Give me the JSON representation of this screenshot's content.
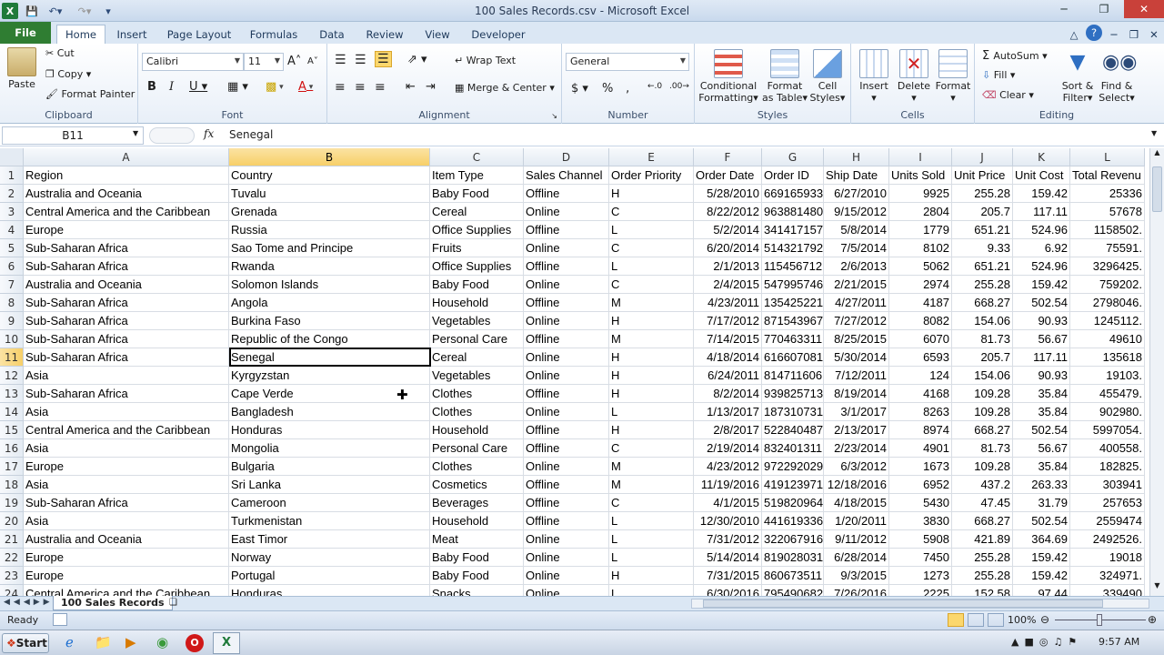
{
  "window": {
    "title": "100 Sales Records.csv - Microsoft Excel"
  },
  "tabs": [
    "File",
    "Home",
    "Insert",
    "Page Layout",
    "Formulas",
    "Data",
    "Review",
    "View",
    "Developer"
  ],
  "ribbon": {
    "clipboard": {
      "label": "Clipboard",
      "paste": "Paste",
      "cut": "Cut",
      "copy": "Copy",
      "format_painter": "Format Painter"
    },
    "font": {
      "label": "Font",
      "name": "Calibri",
      "size": "11"
    },
    "alignment": {
      "label": "Alignment",
      "wrap": "Wrap Text",
      "merge": "Merge & Center"
    },
    "number": {
      "label": "Number",
      "format": "General"
    },
    "styles": {
      "label": "Styles",
      "cond1": "Conditional",
      "cond2": "Formatting",
      "fmt1": "Format",
      "fmt2": "as Table",
      "cell1": "Cell",
      "cell2": "Styles"
    },
    "cells": {
      "label": "Cells",
      "insert": "Insert",
      "delete": "Delete",
      "format": "Format"
    },
    "editing": {
      "label": "Editing",
      "autosum": "AutoSum",
      "fill": "Fill",
      "clear": "Clear",
      "sort1": "Sort &",
      "sort2": "Filter",
      "find1": "Find &",
      "find2": "Select"
    }
  },
  "formula": {
    "name_box": "B11",
    "fx": "fx",
    "value": "Senegal"
  },
  "columns": [
    {
      "letter": "A"
    },
    {
      "letter": "B"
    },
    {
      "letter": "C"
    },
    {
      "letter": "D"
    },
    {
      "letter": "E"
    },
    {
      "letter": "F"
    },
    {
      "letter": "G"
    },
    {
      "letter": "H"
    },
    {
      "letter": "I"
    },
    {
      "letter": "J"
    },
    {
      "letter": "K"
    },
    {
      "letter": "L"
    }
  ],
  "rows": [
    [
      "Region",
      "Country",
      "Item Type",
      "Sales Channel",
      "Order Priority",
      "Order Date",
      "Order ID",
      "Ship Date",
      "Units Sold",
      "Unit Price",
      "Unit Cost",
      "Total Revenu"
    ],
    [
      "Australia and Oceania",
      "Tuvalu",
      "Baby Food",
      "Offline",
      "H",
      "5/28/2010",
      "669165933",
      "6/27/2010",
      "9925",
      "255.28",
      "159.42",
      "25336"
    ],
    [
      "Central America and the Caribbean",
      "Grenada",
      "Cereal",
      "Online",
      "C",
      "8/22/2012",
      "963881480",
      "9/15/2012",
      "2804",
      "205.7",
      "117.11",
      "57678"
    ],
    [
      "Europe",
      "Russia",
      "Office Supplies",
      "Offline",
      "L",
      "5/2/2014",
      "341417157",
      "5/8/2014",
      "1779",
      "651.21",
      "524.96",
      "1158502."
    ],
    [
      "Sub-Saharan Africa",
      "Sao Tome and Principe",
      "Fruits",
      "Online",
      "C",
      "6/20/2014",
      "514321792",
      "7/5/2014",
      "8102",
      "9.33",
      "6.92",
      "75591."
    ],
    [
      "Sub-Saharan Africa",
      "Rwanda",
      "Office Supplies",
      "Offline",
      "L",
      "2/1/2013",
      "115456712",
      "2/6/2013",
      "5062",
      "651.21",
      "524.96",
      "3296425."
    ],
    [
      "Australia and Oceania",
      "Solomon Islands",
      "Baby Food",
      "Online",
      "C",
      "2/4/2015",
      "547995746",
      "2/21/2015",
      "2974",
      "255.28",
      "159.42",
      "759202."
    ],
    [
      "Sub-Saharan Africa",
      "Angola",
      "Household",
      "Offline",
      "M",
      "4/23/2011",
      "135425221",
      "4/27/2011",
      "4187",
      "668.27",
      "502.54",
      "2798046."
    ],
    [
      "Sub-Saharan Africa",
      "Burkina Faso",
      "Vegetables",
      "Online",
      "H",
      "7/17/2012",
      "871543967",
      "7/27/2012",
      "8082",
      "154.06",
      "90.93",
      "1245112."
    ],
    [
      "Sub-Saharan Africa",
      "Republic of the Congo",
      "Personal Care",
      "Offline",
      "M",
      "7/14/2015",
      "770463311",
      "8/25/2015",
      "6070",
      "81.73",
      "56.67",
      "49610"
    ],
    [
      "Sub-Saharan Africa",
      "Senegal",
      "Cereal",
      "Online",
      "H",
      "4/18/2014",
      "616607081",
      "5/30/2014",
      "6593",
      "205.7",
      "117.11",
      "135618"
    ],
    [
      "Asia",
      "Kyrgyzstan",
      "Vegetables",
      "Online",
      "H",
      "6/24/2011",
      "814711606",
      "7/12/2011",
      "124",
      "154.06",
      "90.93",
      "19103."
    ],
    [
      "Sub-Saharan Africa",
      "Cape Verde",
      "Clothes",
      "Offline",
      "H",
      "8/2/2014",
      "939825713",
      "8/19/2014",
      "4168",
      "109.28",
      "35.84",
      "455479."
    ],
    [
      "Asia",
      "Bangladesh",
      "Clothes",
      "Online",
      "L",
      "1/13/2017",
      "187310731",
      "3/1/2017",
      "8263",
      "109.28",
      "35.84",
      "902980."
    ],
    [
      "Central America and the Caribbean",
      "Honduras",
      "Household",
      "Offline",
      "H",
      "2/8/2017",
      "522840487",
      "2/13/2017",
      "8974",
      "668.27",
      "502.54",
      "5997054."
    ],
    [
      "Asia",
      "Mongolia",
      "Personal Care",
      "Offline",
      "C",
      "2/19/2014",
      "832401311",
      "2/23/2014",
      "4901",
      "81.73",
      "56.67",
      "400558."
    ],
    [
      "Europe",
      "Bulgaria",
      "Clothes",
      "Online",
      "M",
      "4/23/2012",
      "972292029",
      "6/3/2012",
      "1673",
      "109.28",
      "35.84",
      "182825."
    ],
    [
      "Asia",
      "Sri Lanka",
      "Cosmetics",
      "Offline",
      "M",
      "11/19/2016",
      "419123971",
      "12/18/2016",
      "6952",
      "437.2",
      "263.33",
      "303941"
    ],
    [
      "Sub-Saharan Africa",
      "Cameroon",
      "Beverages",
      "Offline",
      "C",
      "4/1/2015",
      "519820964",
      "4/18/2015",
      "5430",
      "47.45",
      "31.79",
      "257653"
    ],
    [
      "Asia",
      "Turkmenistan",
      "Household",
      "Offline",
      "L",
      "12/30/2010",
      "441619336",
      "1/20/2011",
      "3830",
      "668.27",
      "502.54",
      "2559474"
    ],
    [
      "Australia and Oceania",
      "East Timor",
      "Meat",
      "Online",
      "L",
      "7/31/2012",
      "322067916",
      "9/11/2012",
      "5908",
      "421.89",
      "364.69",
      "2492526."
    ],
    [
      "Europe",
      "Norway",
      "Baby Food",
      "Online",
      "L",
      "5/14/2014",
      "819028031",
      "6/28/2014",
      "7450",
      "255.28",
      "159.42",
      "19018"
    ],
    [
      "Europe",
      "Portugal",
      "Baby Food",
      "Online",
      "H",
      "7/31/2015",
      "860673511",
      "9/3/2015",
      "1273",
      "255.28",
      "159.42",
      "324971."
    ],
    [
      "Central America and the Caribbean",
      "Honduras",
      "Snacks",
      "Online",
      "L",
      "6/30/2016",
      "795490682",
      "7/26/2016",
      "2225",
      "152.58",
      "97.44",
      "339490"
    ]
  ],
  "sheet_tab": "100 Sales Records",
  "status": {
    "ready": "Ready",
    "zoom": "100%"
  },
  "taskbar": {
    "start": "Start",
    "time": "9:57 AM"
  },
  "colors": {
    "file_tab": "#2f7d32",
    "selection": "#f7cf68"
  }
}
